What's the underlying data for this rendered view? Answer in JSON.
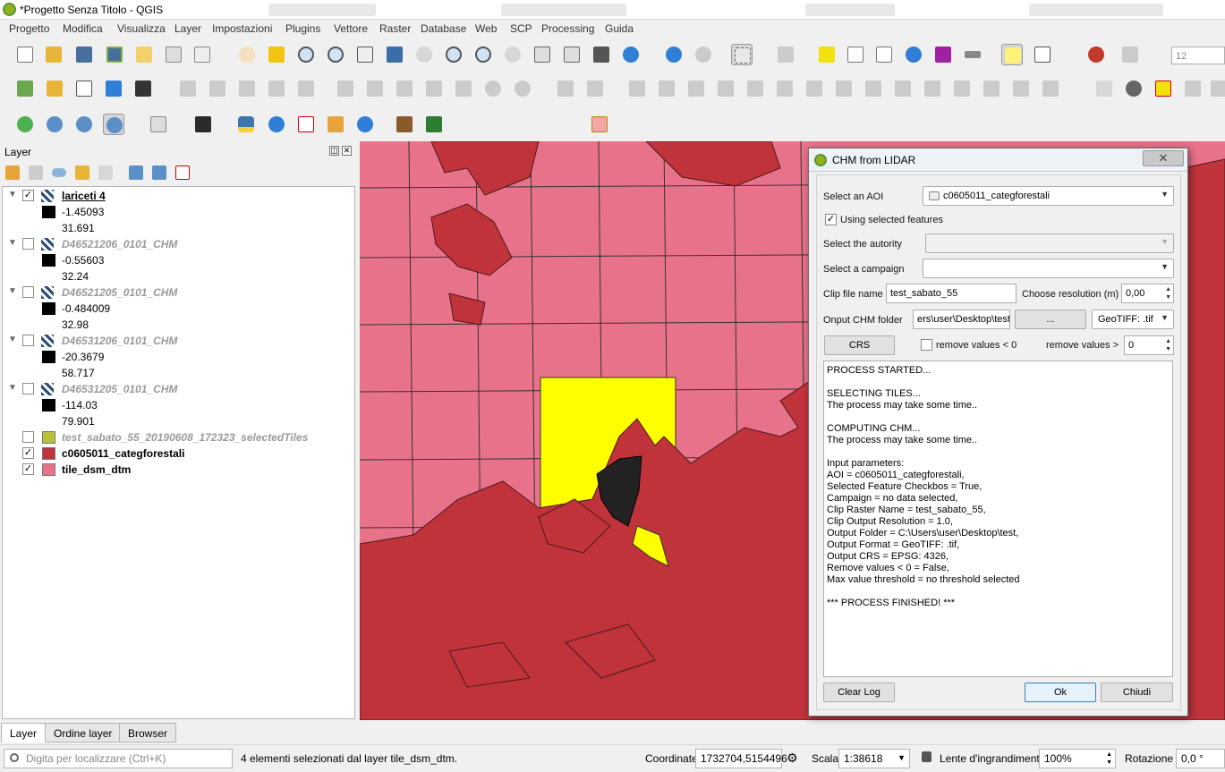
{
  "window": {
    "title": "*Progetto Senza Titolo - QGIS"
  },
  "menu": [
    "Progetto",
    "Modifica",
    "Visualizza",
    "Layer",
    "Impostazioni",
    "Plugins",
    "Vettore",
    "Raster",
    "Database",
    "Web",
    "SCP",
    "Processing",
    "Guida"
  ],
  "toolbar": {
    "font_size_value": "12"
  },
  "layers_panel": {
    "title": "Layer",
    "layers": [
      {
        "name": "lariceti 4",
        "checked": true,
        "min": "-1.45093",
        "max": "31.691"
      },
      {
        "name": "D46521206_0101_CHM",
        "checked": false,
        "min": "-0.55603",
        "max": "32.24"
      },
      {
        "name": "D46521205_0101_CHM",
        "checked": false,
        "min": "-0.484009",
        "max": "32.98"
      },
      {
        "name": "D46531206_0101_CHM",
        "checked": false,
        "min": "-20.3679",
        "max": "58.717"
      },
      {
        "name": "D46531205_0101_CHM",
        "checked": false,
        "min": "-114.03",
        "max": "79.901"
      },
      {
        "name": "test_sabato_55_20190608_172323_selectedTiles",
        "checked": false
      },
      {
        "name": "c0605011_categforestali",
        "checked": true
      },
      {
        "name": "tile_dsm_dtm",
        "checked": true
      }
    ],
    "tabs": [
      "Layer",
      "Ordine layer",
      "Browser"
    ]
  },
  "dialog": {
    "title": "CHM from LIDAR",
    "aoi_label": "Select an AOI",
    "aoi_value": "c0605011_categforestali",
    "use_selected_label": "Using selected features",
    "use_selected_checked": true,
    "autority_label": "Select the autority",
    "autority_value": "",
    "campaign_label": "Select a campaign",
    "campaign_value": "",
    "clip_label": "Clip file name",
    "clip_value": "test_sabato_55",
    "resolution_label": "Choose resolution (m)",
    "resolution_value": "0,00",
    "output_label": "Onput CHM folder",
    "output_value": "ers\\user\\Desktop\\test",
    "browse_label": "...",
    "format_value": "GeoTIFF: .tif",
    "crs_button": "CRS",
    "remove_lt0_label": "remove values < 0",
    "remove_gt_label": "remove values >",
    "remove_gt_value": "0",
    "log_lines": [
      "PROCESS STARTED...",
      "",
      "SELECTING TILES...",
      "The process may take some time..",
      "",
      "COMPUTING CHM...",
      "The process may take some time..",
      "",
      "Input parameters:",
      "AOI = c0605011_categforestali,",
      "Selected Feature Checkbos = True,",
      "Campaign = no data selected,",
      "Clip Raster Name = test_sabato_55,",
      "Clip Output Resolution = 1.0,",
      "Output Folder = C:\\Users\\user\\Desktop\\test,",
      "Output Format = GeoTIFF: .tif,",
      "Output CRS = EPSG: 4326,",
      "Remove values < 0 = False,",
      "Max value threshold = no threshold selected",
      "",
      "*** PROCESS FINISHED! ***"
    ],
    "clear_log": "Clear Log",
    "ok": "Ok",
    "close": "Chiudi",
    "close_x": "✕"
  },
  "statusbar": {
    "search_placeholder": "Digita per localizzare (Ctrl+K)",
    "message": "4 elementi selezionati dal layer tile_dsm_dtm.",
    "coord_label": "Coordinate",
    "coord_value": "1732704,5154496",
    "scale_label": "Scala",
    "scale_value": "1:38618",
    "magnifier_label": "Lente d'ingrandimento",
    "magnifier_value": "100%",
    "rotation_label": "Rotazione",
    "rotation_value": "0,0 °"
  },
  "colors": {
    "tile_fill": "#e8728a",
    "forest_fill": "#c0333b",
    "selected_fill": "#ffff00",
    "chm_fill": "#222222"
  }
}
